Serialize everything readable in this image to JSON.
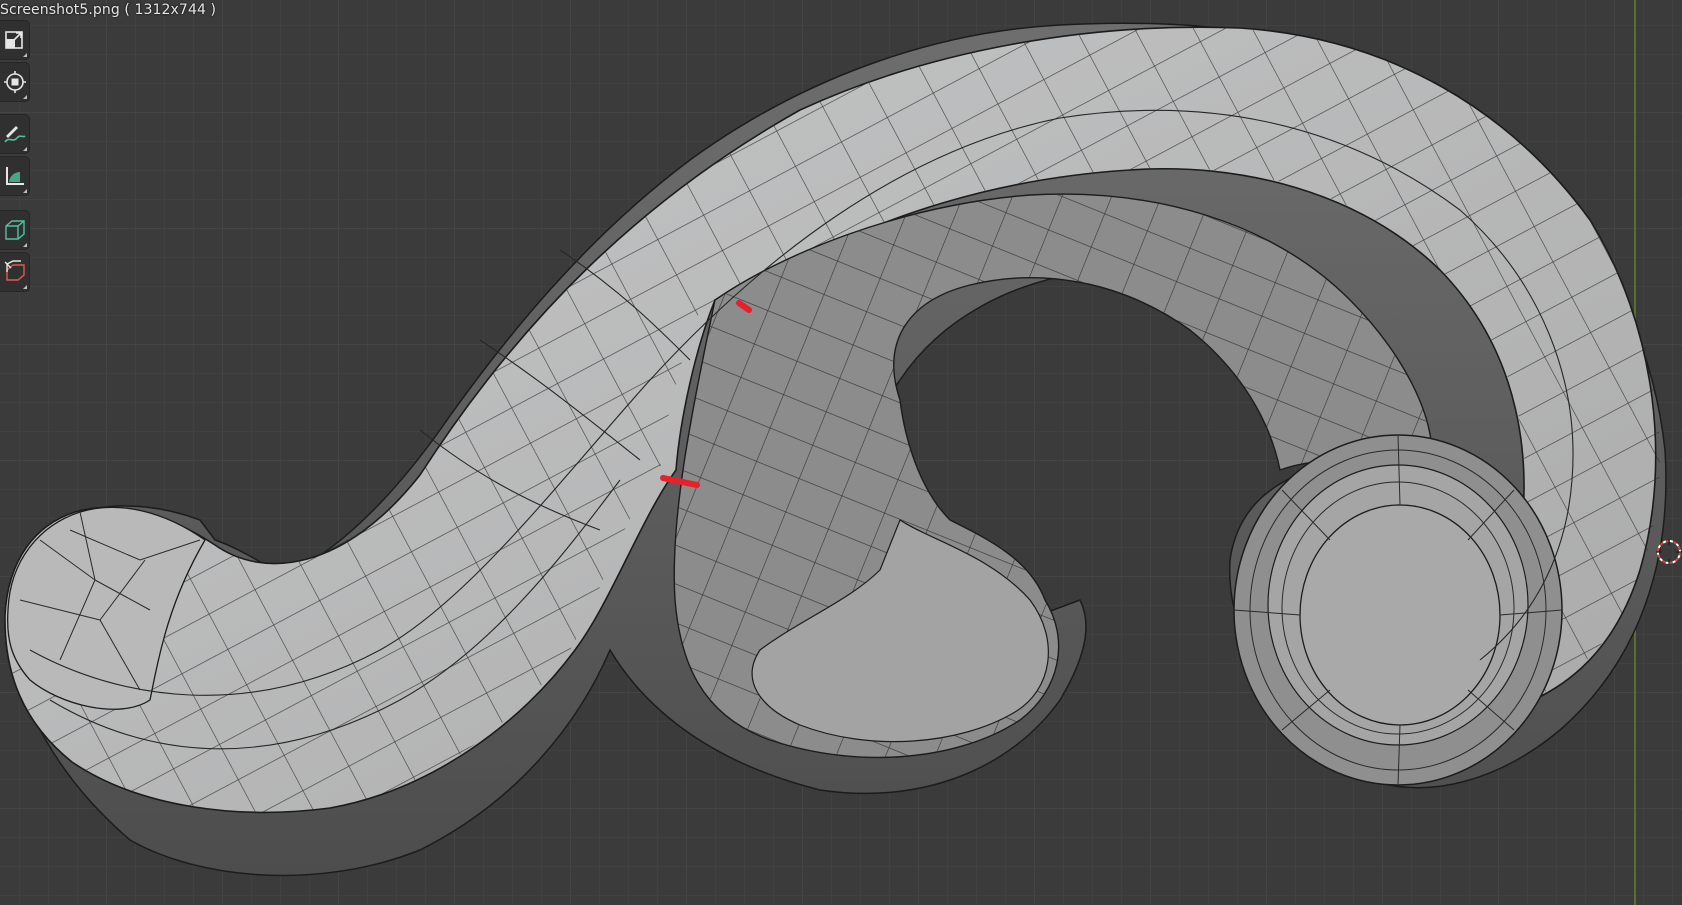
{
  "window": {
    "filename_label": "Screenshot5.png ( 1312x744 )"
  },
  "toolbar": {
    "tools": [
      {
        "name": "scale-tool-icon"
      },
      {
        "name": "transform-tool-icon"
      },
      {
        "name": "annotate-tool-icon"
      },
      {
        "name": "measure-tool-icon"
      },
      {
        "name": "add-cube-tool-icon"
      },
      {
        "name": "extrude-region-tool-icon"
      }
    ]
  },
  "viewport": {
    "background_color": "#3b3b3b",
    "mesh_color": "#b4b4b4",
    "wire_color": "#1c1c1c",
    "annotation_color": "#e8202a",
    "y_axis_color": "#5e7a2a"
  }
}
